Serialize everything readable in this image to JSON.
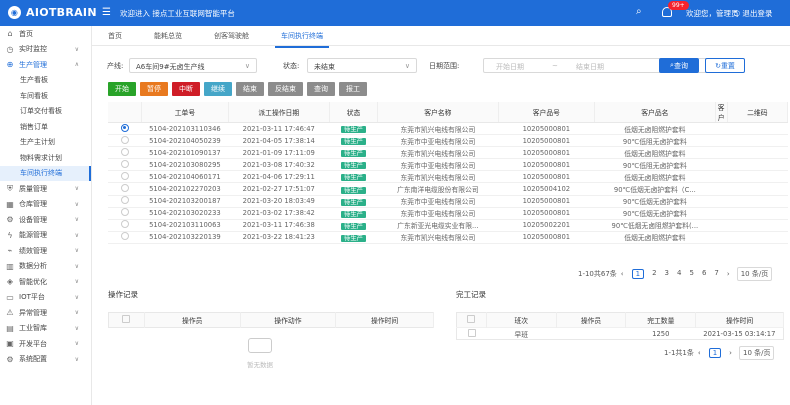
{
  "header": {
    "brand": "AIOTBRAIN",
    "welcome": "欢迎进入 接点工业互联网智能平台",
    "badge": "99+",
    "user": "欢迎您，管理员",
    "logout": "退出登录"
  },
  "sidebar": [
    {
      "label": "首页",
      "icon": "home-icon",
      "chev": false,
      "cls": ""
    },
    {
      "label": "实时监控",
      "icon": "clock-icon",
      "chev": true,
      "cls": ""
    },
    {
      "label": "生产管理",
      "icon": "plus-icon",
      "chev": true,
      "cls": "open"
    },
    {
      "label": "生产看板",
      "icon": "",
      "chev": false,
      "cls": "sub"
    },
    {
      "label": "车间看板",
      "icon": "",
      "chev": false,
      "cls": "sub"
    },
    {
      "label": "订单交付看板",
      "icon": "",
      "chev": false,
      "cls": "sub"
    },
    {
      "label": "销售订单",
      "icon": "",
      "chev": false,
      "cls": "sub"
    },
    {
      "label": "生产主计划",
      "icon": "",
      "chev": false,
      "cls": "sub"
    },
    {
      "label": "物料需求计划",
      "icon": "",
      "chev": false,
      "cls": "sub"
    },
    {
      "label": "车间执行终端",
      "icon": "",
      "chev": false,
      "cls": "sub active"
    },
    {
      "label": "质量管理",
      "icon": "shield-icon",
      "chev": true,
      "cls": ""
    },
    {
      "label": "仓库管理",
      "icon": "warehouse-icon",
      "chev": true,
      "cls": ""
    },
    {
      "label": "设备管理",
      "icon": "device-icon",
      "chev": true,
      "cls": ""
    },
    {
      "label": "能源管理",
      "icon": "energy-icon",
      "chev": true,
      "cls": ""
    },
    {
      "label": "绩效管理",
      "icon": "performance-icon",
      "chev": true,
      "cls": ""
    },
    {
      "label": "数据分析",
      "icon": "analysis-icon",
      "chev": true,
      "cls": ""
    },
    {
      "label": "智能优化",
      "icon": "optimize-icon",
      "chev": true,
      "cls": ""
    },
    {
      "label": "IOT平台",
      "icon": "iot-icon",
      "chev": true,
      "cls": ""
    },
    {
      "label": "异常管理",
      "icon": "alert-icon",
      "chev": true,
      "cls": ""
    },
    {
      "label": "工业智库",
      "icon": "library-icon",
      "chev": true,
      "cls": ""
    },
    {
      "label": "开发平台",
      "icon": "dev-icon",
      "chev": true,
      "cls": ""
    },
    {
      "label": "系统配置",
      "icon": "settings-icon",
      "chev": true,
      "cls": ""
    }
  ],
  "tabs": [
    "首页",
    "能耗总览",
    "创客驾驶舱",
    "车间执行终端"
  ],
  "filters": {
    "line_label": "产线:",
    "line_value": "A6车间9#无卤生产线",
    "status_label": "状态:",
    "status_value": "未结束",
    "date_label": "日期范围:",
    "start": "开始日期",
    "sep": "~",
    "end": "结束日期",
    "query": "查询",
    "reset": "重置"
  },
  "actions": [
    {
      "label": "开始",
      "color": "#29a329"
    },
    {
      "label": "暂停",
      "color": "#e8791f"
    },
    {
      "label": "中断",
      "color": "#cf1d27"
    },
    {
      "label": "继续",
      "color": "#45a6c8"
    },
    {
      "label": "结束",
      "color": "#8c8c8c"
    },
    {
      "label": "反结束",
      "color": "#8c8c8c"
    },
    {
      "label": "查询",
      "color": "#8c8c8c"
    },
    {
      "label": "报工",
      "color": "#8c8c8c"
    }
  ],
  "table": {
    "headers": [
      "",
      "工单号",
      "派工操作日期",
      "状态",
      "客户名称",
      "客户品号",
      "客户品名",
      "客户",
      "二维码"
    ],
    "rows": [
      [
        "5104-202103110346",
        "2021-03-11 17:46:47",
        "待生产",
        "东莞市凯兴电线有限公司",
        "10205000801",
        "低烟无卤阻燃护套料"
      ],
      [
        "5104-202104050239",
        "2021-04-05 17:38:14",
        "待生产",
        "东莞市中亚电线有限公司",
        "10205000801",
        "90℃低阻无卤护套料"
      ],
      [
        "5104-202101090137",
        "2021-01-09 17:11:09",
        "待生产",
        "东莞市凯兴电线有限公司",
        "10205000801",
        "低烟无卤阻燃护套料"
      ],
      [
        "5104-202103080295",
        "2021-03-08 17:40:32",
        "待生产",
        "东莞市中亚电线有限公司",
        "10205000801",
        "90℃低阻无卤护套料"
      ],
      [
        "5104-202104060171",
        "2021-04-06 17:29:11",
        "待生产",
        "东莞市凯兴电线有限公司",
        "10205000801",
        "低烟无卤阻燃护套料"
      ],
      [
        "5104-202102270203",
        "2021-02-27 17:51:07",
        "待生产",
        "广东南洋电缆股份有限公司",
        "10205004102",
        "90℃低烟无卤护套料（C..."
      ],
      [
        "5104-202103200187",
        "2021-03-20 18:03:49",
        "待生产",
        "东莞市中亚电线有限公司",
        "10205000801",
        "90℃低烟无卤护套料"
      ],
      [
        "5104-202103020233",
        "2021-03-02 17:38:42",
        "待生产",
        "东莞市中亚电线有限公司",
        "10205000801",
        "90℃低烟无卤护套料"
      ],
      [
        "5104-202103110063",
        "2021-03-11 17:46:38",
        "待生产",
        "广东新亚光电缆实业有限...",
        "10205002201",
        "90℃低烟无卤阻燃护套料(..."
      ],
      [
        "5104-202103220139",
        "2021-03-22 18:41:23",
        "待生产",
        "东莞市凯兴电线有限公司",
        "10205000801",
        "低烟无卤阻燃护套料"
      ]
    ]
  },
  "pager": {
    "info": "1-10共67条",
    "pages": [
      "1",
      "2",
      "3",
      "4",
      "5",
      "6",
      "7"
    ],
    "size": "10 条/页"
  },
  "oplog": {
    "title": "操作记录",
    "headers": [
      "",
      "操作员",
      "操作动作",
      "操作时间"
    ],
    "empty": "暂无数据"
  },
  "done": {
    "title": "完工记录",
    "headers": [
      "",
      "班次",
      "操作员",
      "完工数量",
      "操作时间"
    ],
    "row": [
      "早班",
      "",
      "1250",
      "2021-03-15 03:14:17"
    ],
    "pager_info": "1-1共1条",
    "page": "1",
    "size": "10 条/页"
  }
}
